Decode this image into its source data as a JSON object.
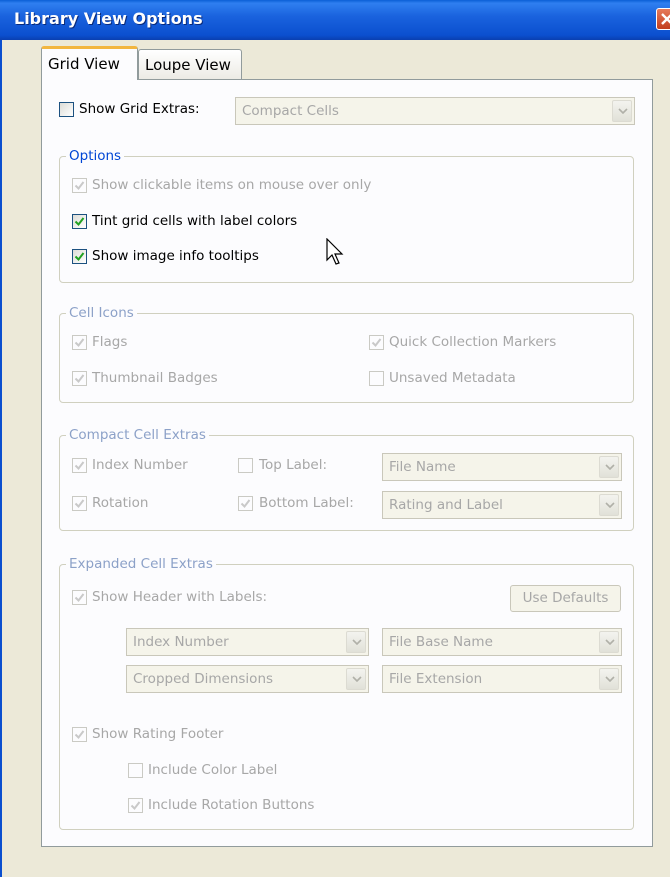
{
  "window": {
    "title": "Library View Options"
  },
  "tabs": [
    {
      "label": "Grid View",
      "active": true
    },
    {
      "label": "Loupe View",
      "active": false
    }
  ],
  "top": {
    "show_grid_extras": {
      "label": "Show Grid Extras:",
      "checked": false
    },
    "grid_style_select": {
      "value": "Compact Cells"
    }
  },
  "options": {
    "legend": "Options",
    "clickable_items": {
      "label": "Show clickable items on mouse over only",
      "checked": true,
      "disabled": true
    },
    "tint_cells": {
      "label": "Tint grid cells with label colors",
      "checked": true,
      "disabled": false
    },
    "image_tooltips": {
      "label": "Show image info tooltips",
      "checked": true,
      "disabled": false
    }
  },
  "cell_icons": {
    "legend": "Cell Icons",
    "flags": {
      "label": "Flags",
      "checked": true
    },
    "quick_collection": {
      "label": "Quick Collection Markers",
      "checked": true
    },
    "thumbnail_badges": {
      "label": "Thumbnail Badges",
      "checked": true
    },
    "unsaved_metadata": {
      "label": "Unsaved Metadata",
      "checked": false
    }
  },
  "compact_extras": {
    "legend": "Compact Cell Extras",
    "index_number": {
      "label": "Index Number",
      "checked": true
    },
    "top_label": {
      "label": "Top Label:",
      "checked": false,
      "value": "File Name"
    },
    "rotation": {
      "label": "Rotation",
      "checked": true
    },
    "bottom_label": {
      "label": "Bottom Label:",
      "checked": true,
      "value": "Rating and Label"
    }
  },
  "expanded_extras": {
    "legend": "Expanded Cell Extras",
    "show_header": {
      "label": "Show Header with Labels:",
      "checked": true
    },
    "use_defaults_label": "Use Defaults",
    "header_selects": [
      "Index Number",
      "File Base Name",
      "Cropped Dimensions",
      "File Extension"
    ],
    "rating_footer": {
      "label": "Show Rating Footer",
      "checked": true
    },
    "include_color_label": {
      "label": "Include Color Label",
      "checked": false
    },
    "include_rotation": {
      "label": "Include Rotation Buttons",
      "checked": true
    }
  },
  "colors": {
    "titlebar": "#0b4fcf",
    "dialog_bg": "#ece9d8",
    "panel_bg": "#fcfcfe",
    "legend_blue": "#0046d5",
    "check_green": "#21a121",
    "disabled_text": "#a7a7a7"
  }
}
